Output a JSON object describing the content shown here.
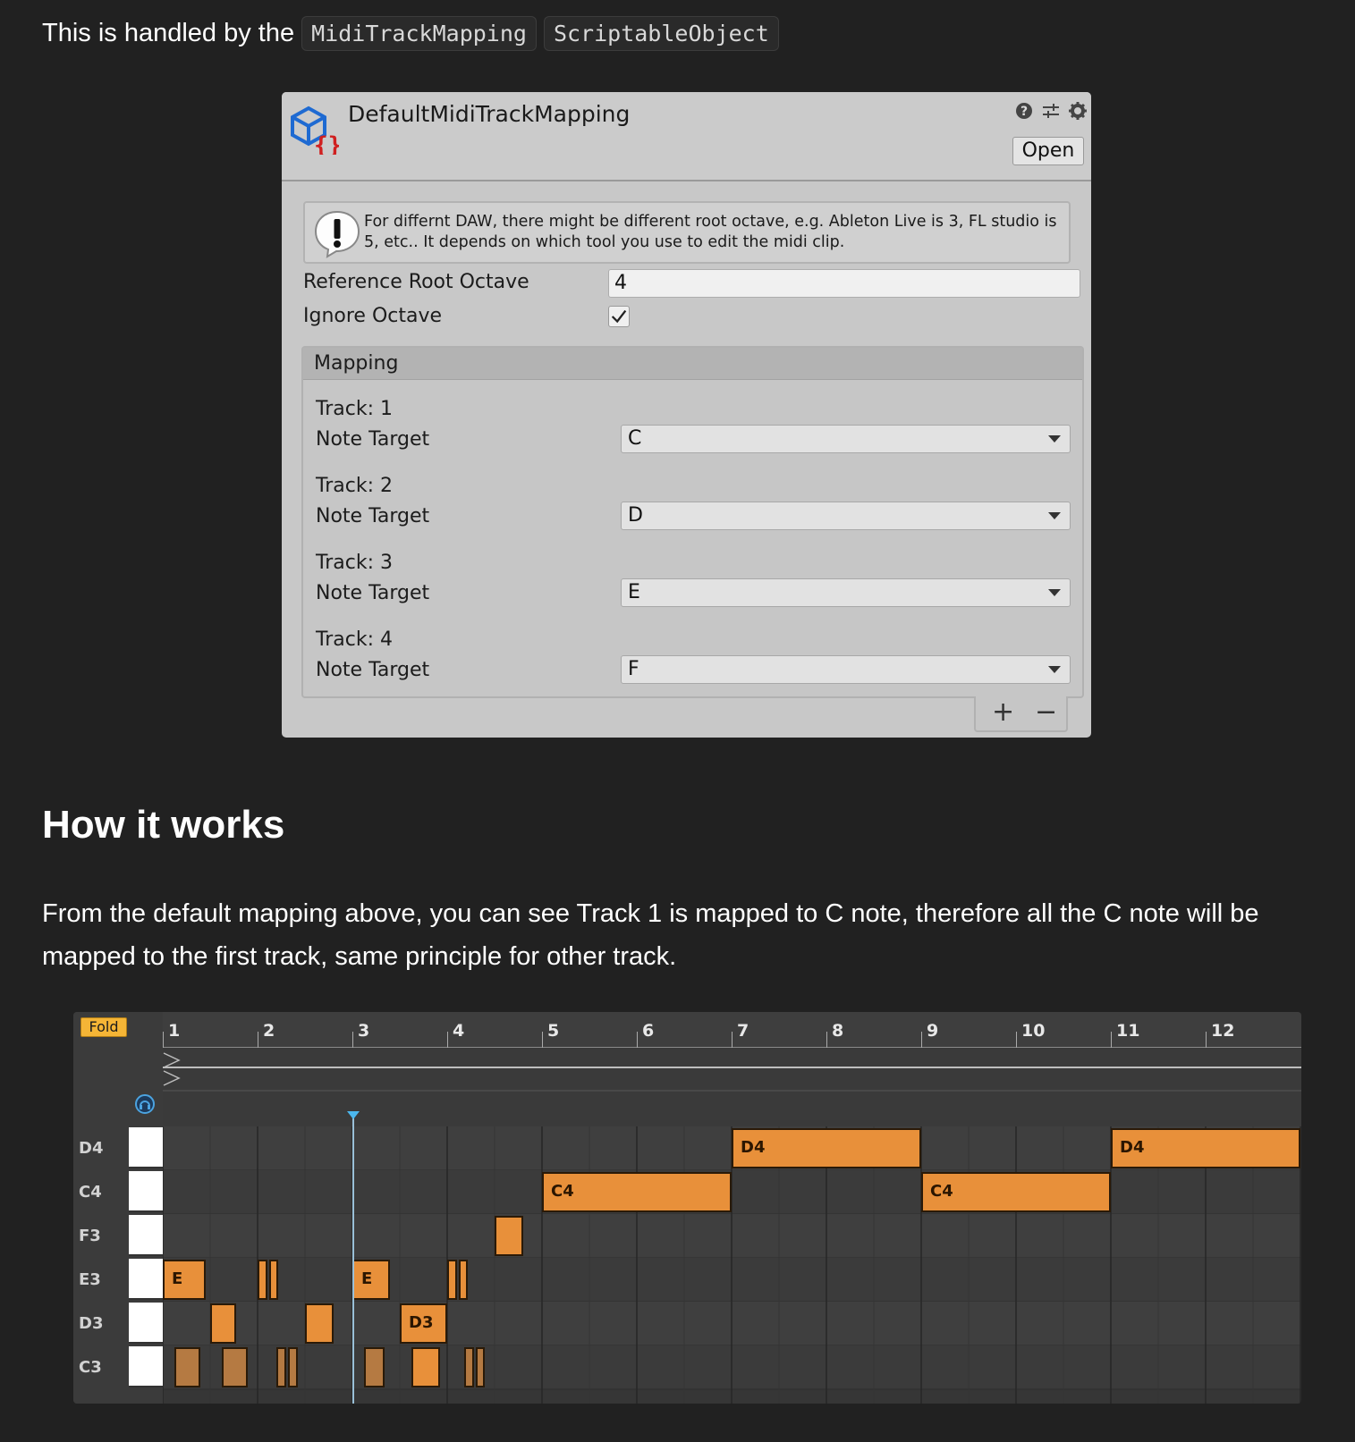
{
  "intro": {
    "text": "This is handled by the",
    "code1": "MidiTrackMapping",
    "code2": "ScriptableObject"
  },
  "inspector": {
    "title": "DefaultMidiTrackMapping",
    "open_label": "Open",
    "header_icons": [
      "help-icon",
      "preset-sliders-icon",
      "gear-icon"
    ],
    "help_text": "For differnt DAW, there might be different root octave, e.g. Ableton Live is 3, FL studio is 5, etc.. It depends on which tool you use to edit the midi clip.",
    "reference_root_octave_label": "Reference Root Octave",
    "reference_root_octave_value": "4",
    "ignore_octave_label": "Ignore Octave",
    "ignore_octave_checked": true,
    "mapping_title": "Mapping",
    "tracks": [
      {
        "track": "Track: 1",
        "note_label": "Note Target",
        "note": "C"
      },
      {
        "track": "Track: 2",
        "note_label": "Note Target",
        "note": "D"
      },
      {
        "track": "Track: 3",
        "note_label": "Note Target",
        "note": "E"
      },
      {
        "track": "Track: 4",
        "note_label": "Note Target",
        "note": "F"
      }
    ],
    "add_label": "+",
    "remove_label": "−"
  },
  "section": {
    "heading": "How it works",
    "paragraph": "From the default mapping above, you can see Track 1 is mapped to C note, therefore all the C note will be mapped to the first track, same principle for other track."
  },
  "piano_roll": {
    "fold_label": "Fold",
    "bars": [
      "1",
      "2",
      "3",
      "4",
      "5",
      "6",
      "7",
      "8",
      "9",
      "10",
      "11",
      "12"
    ],
    "rows": [
      "D4",
      "C4",
      "F3",
      "E3",
      "D3",
      "C3"
    ],
    "accent_color": "#e8903a",
    "notes": [
      {
        "row": 0,
        "start": 7.0,
        "length": 2.0,
        "label": "D4"
      },
      {
        "row": 0,
        "start": 11.0,
        "length": 2.0,
        "label": "D4"
      },
      {
        "row": 1,
        "start": 5.0,
        "length": 2.0,
        "label": "C4"
      },
      {
        "row": 1,
        "start": 9.0,
        "length": 2.0,
        "label": "C4"
      },
      {
        "row": 2,
        "start": 4.5,
        "length": 0.3,
        "label": ""
      },
      {
        "row": 3,
        "start": 1.0,
        "length": 0.45,
        "label": "E"
      },
      {
        "row": 3,
        "start": 2.0,
        "length": 0.1,
        "label": ""
      },
      {
        "row": 3,
        "start": 2.12,
        "length": 0.1,
        "label": ""
      },
      {
        "row": 3,
        "start": 3.0,
        "length": 0.4,
        "label": "E"
      },
      {
        "row": 3,
        "start": 4.0,
        "length": 0.1,
        "label": ""
      },
      {
        "row": 3,
        "start": 4.12,
        "length": 0.1,
        "label": ""
      },
      {
        "row": 4,
        "start": 1.5,
        "length": 0.27,
        "label": ""
      },
      {
        "row": 4,
        "start": 2.5,
        "length": 0.3,
        "label": ""
      },
      {
        "row": 4,
        "start": 3.5,
        "length": 0.5,
        "label": "D3"
      },
      {
        "row": 5,
        "start": 1.12,
        "length": 0.28,
        "label": "",
        "dim": true
      },
      {
        "row": 5,
        "start": 1.62,
        "length": 0.28,
        "label": "",
        "dim": true
      },
      {
        "row": 5,
        "start": 2.2,
        "length": 0.1,
        "label": "",
        "dim": true
      },
      {
        "row": 5,
        "start": 2.32,
        "length": 0.1,
        "label": "",
        "dim": true
      },
      {
        "row": 5,
        "start": 3.12,
        "length": 0.22,
        "label": "",
        "dim": true
      },
      {
        "row": 5,
        "start": 3.62,
        "length": 0.3,
        "label": ""
      },
      {
        "row": 5,
        "start": 4.18,
        "length": 0.1,
        "label": "",
        "dim": true
      },
      {
        "row": 5,
        "start": 4.3,
        "length": 0.1,
        "label": "",
        "dim": true
      }
    ],
    "playhead_bar": 3.0
  }
}
